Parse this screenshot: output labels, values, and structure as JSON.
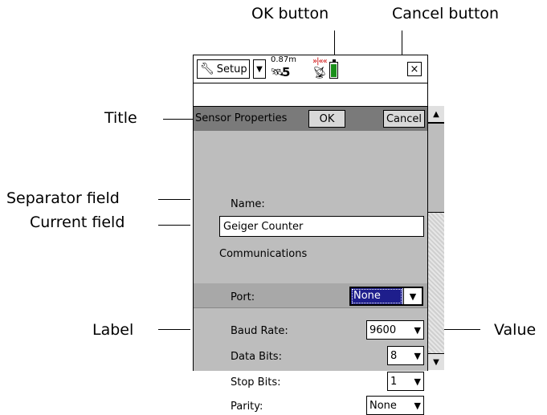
{
  "callouts": {
    "ok_button": "OK button",
    "cancel_button": "Cancel button",
    "title": "Title",
    "separator_field": "Separator field",
    "current_field": "Current field",
    "label": "Label",
    "value": "Value"
  },
  "taskbar": {
    "setup_label": "Setup",
    "gps_accuracy": "0.87m",
    "satellite_count": "5",
    "radio_indicator": "»|««",
    "close": "×"
  },
  "form": {
    "title": "Sensor Properties",
    "ok_label": "OK",
    "cancel_label": "Cancel",
    "name_label": "Name:",
    "name_value": "Geiger Counter",
    "separator_label": "Communications",
    "fields": [
      {
        "label": "Port:",
        "value": "None"
      },
      {
        "label": "Baud Rate:",
        "value": "9600"
      },
      {
        "label": "Data Bits:",
        "value": "8"
      },
      {
        "label": "Stop Bits:",
        "value": "1"
      },
      {
        "label": "Parity:",
        "value": "None"
      }
    ]
  },
  "icons": {
    "setup": "wrench-icon",
    "satellite": "satellite-icon",
    "radio": "radio-icon",
    "battery": "battery-icon",
    "dropdown": "chevron-down-icon",
    "scroll_up": "scroll-up-icon",
    "scroll_down": "scroll-down-icon"
  },
  "colors": {
    "titlebar": "#7a7a7a",
    "content_bg": "#bdbdbd",
    "selection": "#1e1e8c",
    "battery_fill": "#1a8f1a"
  }
}
